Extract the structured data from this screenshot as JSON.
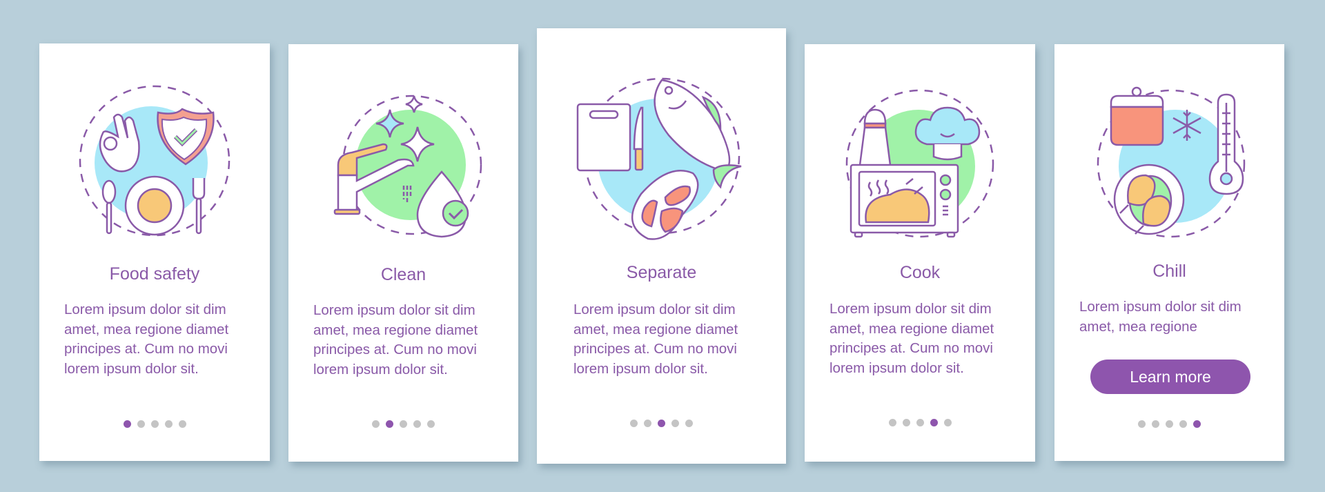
{
  "colors": {
    "background": "#b8cfda",
    "card": "#ffffff",
    "accent": "#8e55ad",
    "text": "#8a5aa8",
    "dot_inactive": "#c4c4c4",
    "blue_blob": "#a8e8f8",
    "green_blob": "#a0f2a8",
    "orange": "#f8c878",
    "salmon": "#f8947c"
  },
  "screens": [
    {
      "title": "Food safety",
      "description": "Lorem ipsum dolor sit dim amet, mea regione diamet principes at. Cum no movi lorem ipsum dolor sit.",
      "icons": [
        "ok-hand-icon",
        "shield-check-icon",
        "spoon-icon",
        "plate-icon",
        "fork-icon"
      ],
      "active_page": 1,
      "page_count": 5
    },
    {
      "title": "Clean",
      "description": "Lorem ipsum dolor sit dim amet, mea regione diamet principes at. Cum no movi lorem ipsum dolor sit.",
      "icons": [
        "faucet-icon",
        "sparkle-icon",
        "water-drop-check-icon"
      ],
      "active_page": 2,
      "page_count": 5
    },
    {
      "title": "Separate",
      "description": "Lorem ipsum dolor sit dim amet, mea regione diamet principes at. Cum no movi lorem ipsum dolor sit.",
      "icons": [
        "cutting-board-icon",
        "knife-icon",
        "fish-icon",
        "steak-icon"
      ],
      "active_page": 3,
      "page_count": 5
    },
    {
      "title": "Cook",
      "description": "Lorem ipsum dolor sit dim amet, mea regione diamet principes at. Cum no movi lorem ipsum dolor sit.",
      "icons": [
        "salt-shaker-icon",
        "chef-hat-icon",
        "oven-chicken-icon"
      ],
      "active_page": 4,
      "page_count": 5
    },
    {
      "title": "Chill",
      "description": "Lorem ipsum dolor sit dim amet, mea regione",
      "icons": [
        "pot-icon",
        "snowflake-icon",
        "thermometer-icon",
        "chicken-legs-plate-icon"
      ],
      "button_label": "Learn more",
      "active_page": 5,
      "page_count": 5
    }
  ]
}
